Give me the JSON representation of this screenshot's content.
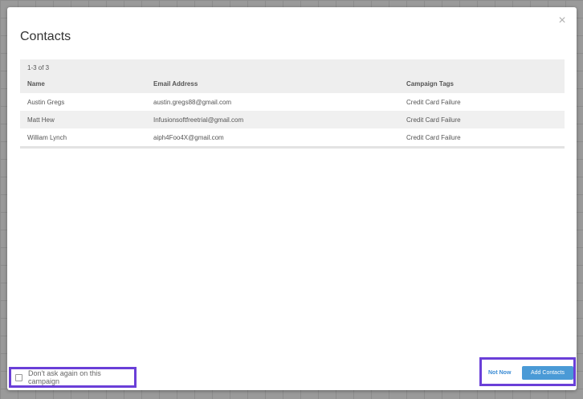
{
  "modal": {
    "title": "Contacts",
    "close_label": "×"
  },
  "table": {
    "count": "1-3 of 3",
    "headers": [
      "Name",
      "Email Address",
      "Campaign Tags"
    ],
    "rows": [
      [
        "Austin Gregs",
        "austin.gregs88@gmail.com",
        "Credit Card Failure"
      ],
      [
        "Matt Hew",
        "Infusionsoftfreetrial@gmail.com",
        "Credit Card Failure"
      ],
      [
        "William Lynch",
        "aiph4Foo4X@gmail.com",
        "Credit Card Failure"
      ]
    ]
  },
  "footer": {
    "checkbox_label": "Don't ask again on this campaign",
    "not_now_label": "Not Now",
    "add_contacts_label": "Add Contacts"
  },
  "colors": {
    "accent": "#4a9ad6",
    "highlight_border": "#6a3fd8"
  }
}
